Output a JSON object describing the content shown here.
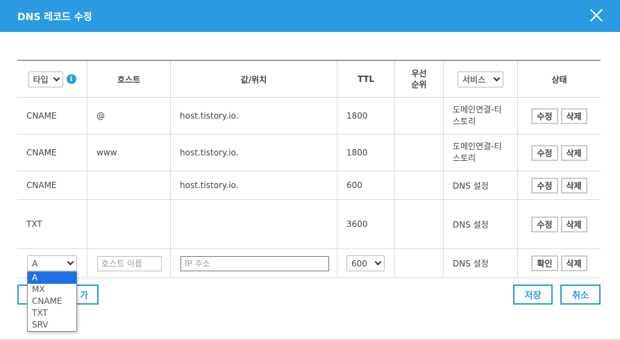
{
  "dialog": {
    "title": "DNS 레코드 수정"
  },
  "header": {
    "type_select": "타입",
    "host": "호스트",
    "value": "값/위치",
    "ttl": "TTL",
    "priority": "우선\n순위",
    "service_select": "서비스",
    "status": "상태"
  },
  "records": [
    {
      "type": "CNAME",
      "host": "@",
      "value": "host.tistory.io.",
      "ttl": "1800",
      "priority": "",
      "service": "도메인연결-티\n스토리",
      "edit": "수정",
      "delete": "삭제"
    },
    {
      "type": "CNAME",
      "host": "www",
      "value": "host.tistory.io.",
      "ttl": "1800",
      "priority": "",
      "service": "도메인연결-티\n스토리",
      "edit": "수정",
      "delete": "삭제"
    },
    {
      "type": "CNAME",
      "host": "",
      "value": "host.tistory.io.",
      "ttl": "600",
      "priority": "",
      "service": "DNS 설정",
      "edit": "수정",
      "delete": "삭제"
    },
    {
      "type": "TXT",
      "host": "",
      "value": "",
      "ttl": "3600",
      "priority": "",
      "service": "DNS 설정",
      "edit": "수정",
      "delete": "삭제"
    }
  ],
  "new_record": {
    "type_value": "A",
    "host_placeholder": "호스트 이름",
    "value_placeholder": "IP 주소",
    "ttl_value": "600",
    "service": "DNS 설정",
    "confirm": "확인",
    "delete": "삭제"
  },
  "type_options": [
    "A",
    "MX",
    "CNAME",
    "TXT",
    "SRV"
  ],
  "footer": {
    "add_partial": "가",
    "save": "저장",
    "cancel": "취소"
  },
  "colors": {
    "accent": "#2a9be3",
    "selected_option": "#1e70e6"
  }
}
